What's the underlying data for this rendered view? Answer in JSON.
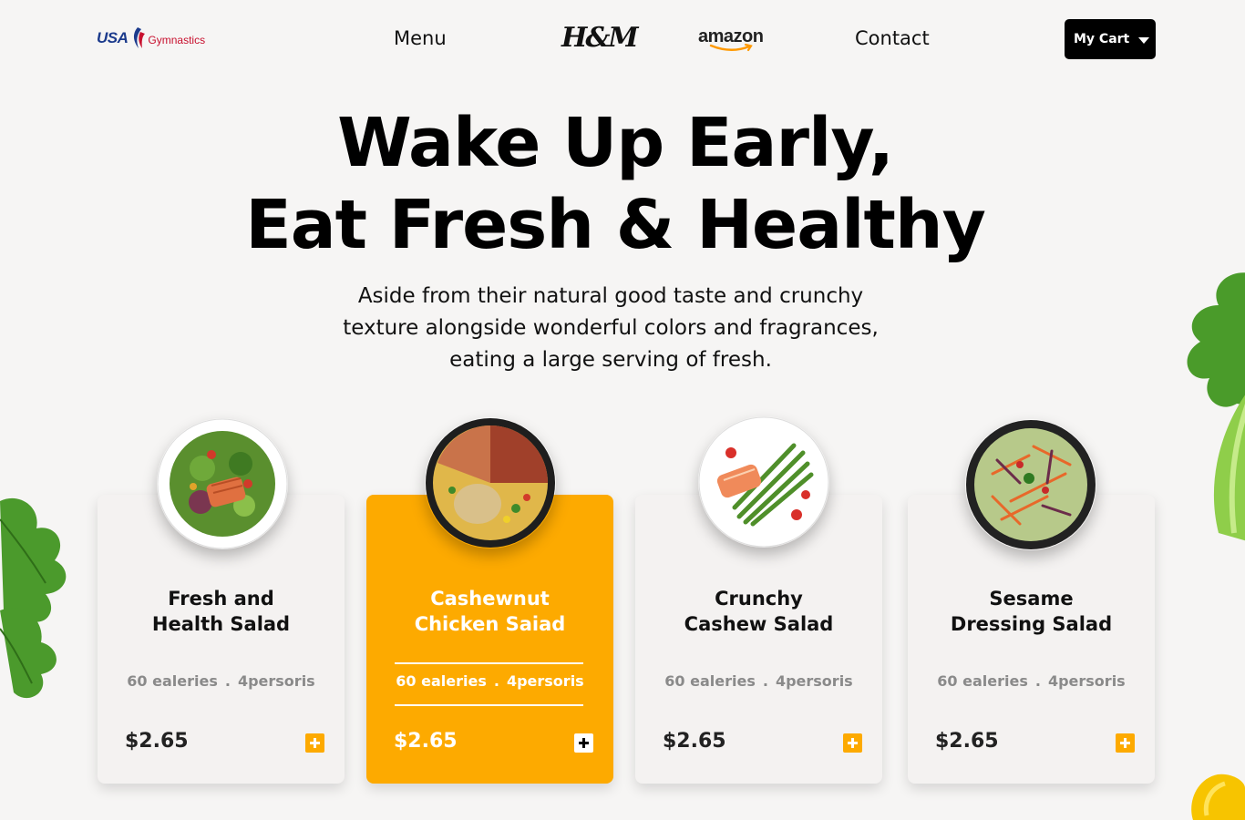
{
  "nav": {
    "logo_usa_brand": "USA",
    "logo_usa_sub": "Gymnastics",
    "menu_label": "Menu",
    "logo_hm": "H&M",
    "logo_amazon": "amazon",
    "contact_label": "Contact",
    "cart_label": "My Cart"
  },
  "hero": {
    "title_line1": "Wake Up Early,",
    "title_line2": "Eat Fresh & Healthy",
    "subtitle_line1": "Aside from their natural good taste and crunchy",
    "subtitle_line2": "texture alongside wonderful colors and fragrances,",
    "subtitle_line3": "eating a large serving of fresh."
  },
  "colors": {
    "accent": "#fdaa00",
    "background": "#f6f5f4",
    "card": "#f4f2f1"
  },
  "cards": [
    {
      "title_line1": "Fresh and",
      "title_line2": "Health Salad",
      "calories": "60 ealeries",
      "dot": ".",
      "persons": "4persoris",
      "price": "$2.65",
      "active": false
    },
    {
      "title_line1": "Cashewnut",
      "title_line2": "Chicken Saiad",
      "calories": "60 ealeries",
      "dot": ".",
      "persons": "4persoris",
      "price": "$2.65",
      "active": true
    },
    {
      "title_line1": "Crunchy",
      "title_line2": "Cashew Salad",
      "calories": "60 ealeries",
      "dot": ".",
      "persons": "4persoris",
      "price": "$2.65",
      "active": false
    },
    {
      "title_line1": "Sesame",
      "title_line2": "Dressing Salad",
      "calories": "60 ealeries",
      "dot": ".",
      "persons": "4persoris",
      "price": "$2.65",
      "active": false
    }
  ]
}
